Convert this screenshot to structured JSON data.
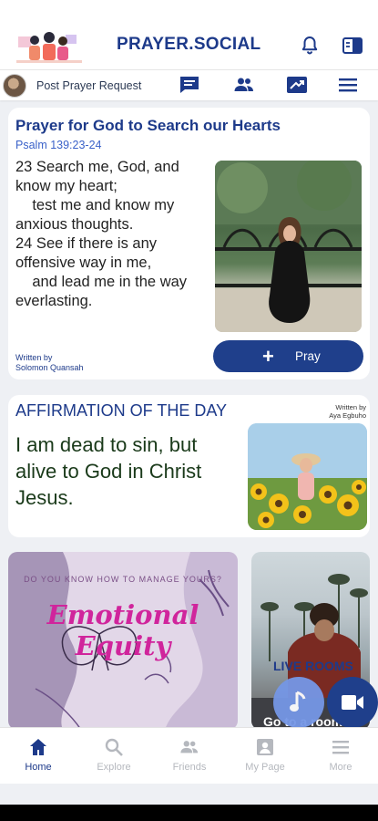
{
  "header": {
    "app_title": "PRAYER.SOCIAL",
    "logo_icon": "people-illustration-logo",
    "icons": [
      "bell-icon",
      "book-icon"
    ]
  },
  "subbar": {
    "post_label": "Post Prayer Request",
    "icons": [
      "chat-icon",
      "friends-icon",
      "share-icon",
      "menu-icon"
    ]
  },
  "prayer_card": {
    "title": "Prayer for God to Search our Hearts",
    "reference": "Psalm 139:23-24",
    "body": "23 Search me, God, and know my heart;\n    test me and know my anxious thoughts.\n24 See if there is any offensive way in me,\n    and lead me in the way everlasting.",
    "written_by": "Written by",
    "author": "Solomon Quansah",
    "pray_label": "Pray"
  },
  "affirmation": {
    "title": "AFFIRMATION OF THE DAY",
    "written_by": "Written by",
    "author": "Aya Egbuho",
    "text": "I am dead to sin, but alive to God in Christ Jesus."
  },
  "tiles": {
    "left": {
      "question": "DO YOU KNOW HOW TO MANAGE YOURS?",
      "title": "Emotional Equity"
    },
    "right": {
      "label": "LIVE ROOMS",
      "caption": "Go to a room"
    }
  },
  "fabs": {
    "music_icon": "music-note-icon",
    "video_icon": "video-camera-icon"
  },
  "tabbar": {
    "tabs": [
      {
        "label": "Home",
        "icon": "home-icon",
        "active": true
      },
      {
        "label": "Explore",
        "icon": "search-icon",
        "active": false
      },
      {
        "label": "Friends",
        "icon": "friends-icon",
        "active": false
      },
      {
        "label": "My Page",
        "icon": "profile-page-icon",
        "active": false
      },
      {
        "label": "More",
        "icon": "menu-icon",
        "active": false
      }
    ]
  },
  "colors": {
    "brand": "#1d3a8a",
    "accent": "#1f3f8b",
    "background": "#eef0f4",
    "inactive": "#b5b8be"
  }
}
